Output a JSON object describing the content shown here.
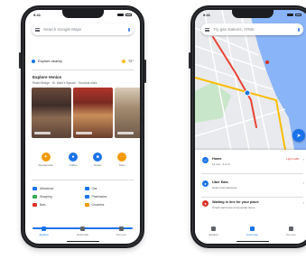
{
  "left_phone": {
    "status_time": "9:41",
    "search_placeholder": "Search Google Maps",
    "chip_text": "Explore nearby",
    "chip_weather": "72°",
    "explore_title": "Explore Venice",
    "explore_sub": "Rialto Bridge · St. Mark's Square · Gondola rides",
    "categories": [
      {
        "label": "Restaurants",
        "color": "#f29900",
        "icon": "fork-knife-icon",
        "glyph": "✦"
      },
      {
        "label": "Coffee",
        "color": "#1a73e8",
        "icon": "coffee-icon",
        "glyph": "●"
      },
      {
        "label": "Hotels",
        "color": "#1a73e8",
        "icon": "bed-icon",
        "glyph": "■"
      },
      {
        "label": "More",
        "color": "#f29900",
        "icon": "more-icon",
        "glyph": "⋯"
      }
    ],
    "more_items": [
      {
        "label": "Attractions",
        "color": "#1a73e8"
      },
      {
        "label": "Gas",
        "color": "#1a73e8"
      },
      {
        "label": "Shopping",
        "color": "#34a853"
      },
      {
        "label": "Pharmacies",
        "color": "#1a73e8"
      },
      {
        "label": "Bars",
        "color": "#d93025"
      },
      {
        "label": "Groceries",
        "color": "#f29900"
      }
    ],
    "progress": 1.0,
    "nav": [
      {
        "label": "Explore",
        "color": "#1a73e8"
      },
      {
        "label": "Commute",
        "color": "#5f6368"
      },
      {
        "label": "For you",
        "color": "#5f6368"
      }
    ]
  },
  "right_phone": {
    "status_time": "9:41",
    "search_placeholder": "Try gas stations, ATMs",
    "rows": [
      {
        "title": "Home",
        "sub": "12 min · 4.2 mi",
        "meta": "Light traffic",
        "color": "#1a73e8",
        "icon": "home-icon",
        "glyph": "⌂"
      },
      {
        "title": "Uber Eats",
        "sub": "Order food delivered",
        "meta": "",
        "color": "#1a73e8",
        "icon": "car-icon",
        "glyph": "●"
      },
      {
        "title": "Waiting in line for your place",
        "sub": "Check wait times and popular times",
        "meta": "",
        "color": "#d93025",
        "icon": "pin-icon",
        "glyph": "●"
      }
    ],
    "nav": [
      {
        "label": "Explore",
        "color": "#5f6368"
      },
      {
        "label": "Commute",
        "color": "#1a73e8"
      },
      {
        "label": "For you",
        "color": "#5f6368"
      }
    ]
  },
  "colors": {
    "water": "#8ab4f8",
    "land": "#e8eaed",
    "park": "#c8e6c9",
    "road_major": "#fbbc04",
    "route": "#ea4335"
  }
}
